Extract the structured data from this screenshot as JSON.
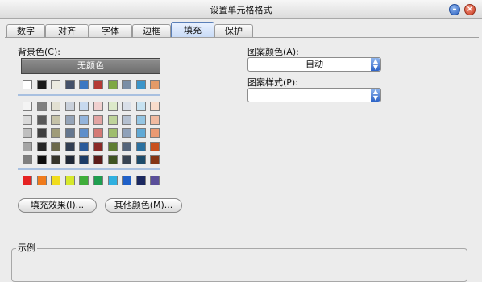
{
  "window": {
    "title": "设置单元格格式",
    "min_icon": "minimize-icon",
    "close_icon": "close-icon"
  },
  "tabs": [
    {
      "label": "数字"
    },
    {
      "label": "对齐"
    },
    {
      "label": "字体"
    },
    {
      "label": "边框"
    },
    {
      "label": "填充",
      "active": true
    },
    {
      "label": "保护"
    }
  ],
  "fill": {
    "background_label": "背景色(C):",
    "no_color_label": "无颜色",
    "theme_row": [
      "#ffffff",
      "#1a1a1a",
      "#ecebe1",
      "#45526b",
      "#3c78c2",
      "#b53a35",
      "#7ea844",
      "#7a8ea6",
      "#3c95c9",
      "#e39a67"
    ],
    "tint_rows": [
      [
        "#f4f4f4",
        "#7f7f7f",
        "#e2e0d2",
        "#c9d0db",
        "#c7d9ee",
        "#f0d0cf",
        "#dce9c9",
        "#d9dfe8",
        "#c7e2f1",
        "#f8dccb"
      ],
      [
        "#d9d9d9",
        "#595959",
        "#c5c2a8",
        "#95a4b8",
        "#93b4dc",
        "#e2a4a2",
        "#bed39a",
        "#b4c0d0",
        "#94c5e3",
        "#f1baa0"
      ],
      [
        "#bfbfbf",
        "#3f3f3f",
        "#a09c79",
        "#65778f",
        "#5f8fca",
        "#d47974",
        "#9fbd6d",
        "#8fa1b9",
        "#61a9d5",
        "#eb9a73"
      ],
      [
        "#a5a5a5",
        "#262626",
        "#6b684a",
        "#323e52",
        "#2b5b9a",
        "#8a2a27",
        "#5f7e33",
        "#55657b",
        "#2c71a0",
        "#c8501e"
      ],
      [
        "#7f7f7f",
        "#0d0d0d",
        "#36342a",
        "#1f2837",
        "#1c3c67",
        "#5c1c1a",
        "#3f5422",
        "#384453",
        "#1c4b6b",
        "#853514"
      ]
    ],
    "standard_row": [
      "#e52222",
      "#f07b1c",
      "#f1dc1c",
      "#d6e82c",
      "#3fae3a",
      "#1f9e4f",
      "#2fb0e0",
      "#1f60c8",
      "#1b2860",
      "#5a4f9a"
    ],
    "fill_effects_button": "填充效果(I)...",
    "more_colors_button": "其他颜色(M)...",
    "pattern_color_label": "图案颜色(A):",
    "pattern_color_value": "自动",
    "pattern_style_label": "图案样式(P):",
    "pattern_style_value": "",
    "sample_label": "示例"
  }
}
